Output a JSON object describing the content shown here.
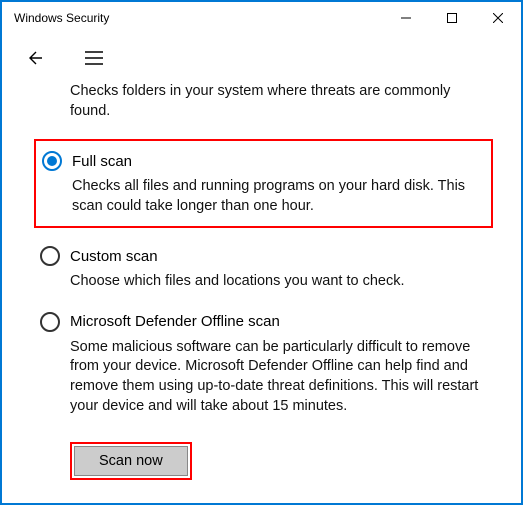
{
  "window": {
    "title": "Windows Security"
  },
  "intro": "Checks folders in your system where threats are commonly found.",
  "options": {
    "full": {
      "label": "Full scan",
      "desc": "Checks all files and running programs on your hard disk. This scan could take longer than one hour."
    },
    "custom": {
      "label": "Custom scan",
      "desc": "Choose which files and locations you want to check."
    },
    "offline": {
      "label": "Microsoft Defender Offline scan",
      "desc": "Some malicious software can be particularly difficult to remove from your device. Microsoft Defender Offline can help find and remove them using up-to-date threat definitions. This will restart your device and will take about 15 minutes."
    }
  },
  "actions": {
    "scan_now": "Scan now"
  }
}
